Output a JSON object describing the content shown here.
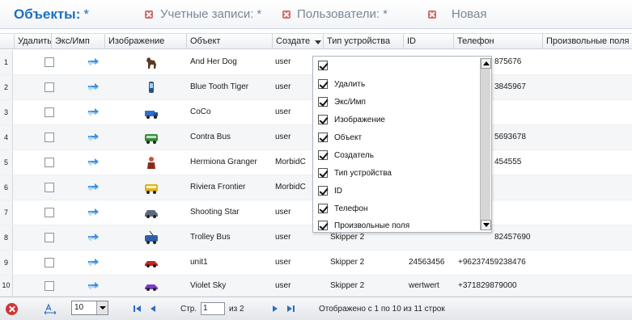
{
  "tabs": [
    {
      "label": "Объекты:",
      "modified": "*",
      "active": true
    },
    {
      "label": "Учетные записи:",
      "modified": "*",
      "active": false
    },
    {
      "label": "Пользователи:",
      "modified": "*",
      "active": false
    },
    {
      "label": "Новая",
      "modified": "",
      "active": false
    }
  ],
  "columns": {
    "delete": "Удалить",
    "export": "Экс/Имп",
    "image": "Изображение",
    "object": "Объект",
    "creator": "Создате",
    "device_type": "Тип устройства",
    "id": "ID",
    "phone": "Телефон",
    "custom_fields": "Произвольные поля"
  },
  "rows": [
    {
      "num": "1",
      "object": "And Her Dog",
      "creator": "user",
      "device": "",
      "id": "",
      "phone": "875676",
      "icon": "dog-icon"
    },
    {
      "num": "2",
      "object": "Blue Tooth Tiger",
      "creator": "user",
      "device": "",
      "id": "",
      "phone": "3845967",
      "icon": "phone-icon"
    },
    {
      "num": "3",
      "object": "CoCo",
      "creator": "user",
      "device": "",
      "id": "",
      "phone": "",
      "icon": "truck-icon"
    },
    {
      "num": "4",
      "object": "Contra Bus",
      "creator": "user",
      "device": "",
      "id": "",
      "phone": "5693678",
      "icon": "bus-icon"
    },
    {
      "num": "5",
      "object": "Hermiona Granger",
      "creator": "MorbidC",
      "device": "",
      "id": "",
      "phone": "454555",
      "icon": "person-icon"
    },
    {
      "num": "6",
      "object": "Riviera Frontier",
      "creator": "MorbidC",
      "device": "",
      "id": "",
      "phone": "",
      "icon": "yellow-bus-icon"
    },
    {
      "num": "7",
      "object": "Shooting Star",
      "creator": "user",
      "device": "",
      "id": "",
      "phone": "",
      "icon": "car-icon"
    },
    {
      "num": "8",
      "object": "Trolley Bus",
      "creator": "user",
      "device": "Skipper 2",
      "id": "",
      "phone": "82457690",
      "icon": "trolley-icon"
    },
    {
      "num": "9",
      "object": "unit1",
      "creator": "user",
      "device": "Skipper 2",
      "id": "24563456",
      "phone": "+96237459238476",
      "icon": "red-car-icon"
    },
    {
      "num": "10",
      "object": "Violet Sky",
      "creator": "user",
      "device": "Skipper 2",
      "id": "wertwert",
      "phone": "+371829879000",
      "icon": "purple-car-icon"
    }
  ],
  "column_chooser": {
    "options": [
      {
        "label": "",
        "checked": true
      },
      {
        "label": "Удалить",
        "checked": true
      },
      {
        "label": "Экс/Имп",
        "checked": true
      },
      {
        "label": "Изображение",
        "checked": true
      },
      {
        "label": "Объект",
        "checked": true
      },
      {
        "label": "Создатель",
        "checked": true
      },
      {
        "label": "Тип устройства",
        "checked": true
      },
      {
        "label": "ID",
        "checked": true
      },
      {
        "label": "Телефон",
        "checked": true
      },
      {
        "label": "Произвольные поля",
        "checked": true
      }
    ]
  },
  "footer": {
    "page_size": "10",
    "page_label": "Стр.",
    "page_value": "1",
    "of_label": "из 2",
    "status": "Отображено с 1 по 10 из 11 строк"
  },
  "colors": {
    "accent": "#1b6fc4",
    "tab_inactive": "#7a8796",
    "export_arrow": "#3b8fe0",
    "delete_red": "#d03434"
  }
}
